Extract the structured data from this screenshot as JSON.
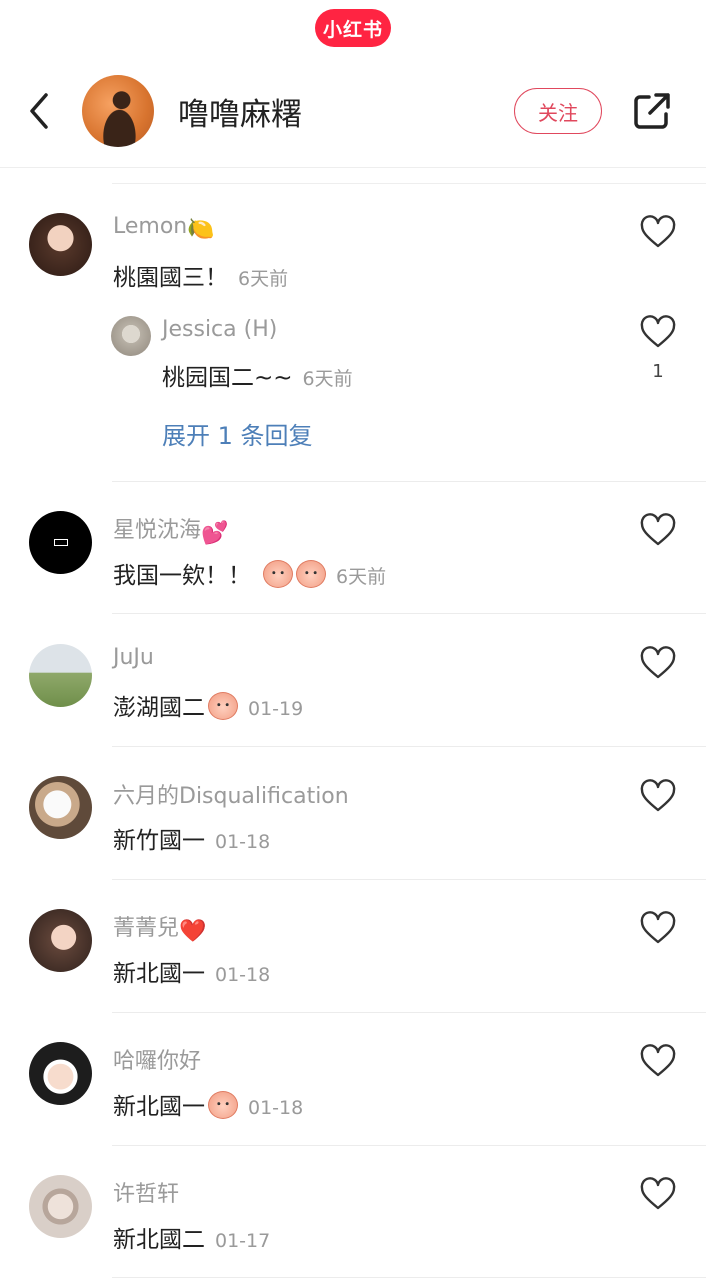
{
  "app": {
    "brand": "小红书",
    "brand_color": "#ff2442"
  },
  "header": {
    "author_name": "噜噜麻糬",
    "follow_label": "关注",
    "icons": {
      "back": "chevron-left-icon",
      "share": "share-external-icon"
    }
  },
  "comments": [
    {
      "user": "Lemon",
      "user_emoji": "🍋",
      "text": "桃園國三！",
      "date": "6天前",
      "reply": {
        "user": "Jessica (H)",
        "text": "桃园国二~~",
        "date": "6天前",
        "likes": "1"
      },
      "expand_label": "展开 1 条回复"
    },
    {
      "user": "星悦沈海",
      "user_emoji": "💕",
      "text": "我国一欸！！",
      "date": "6天前"
    },
    {
      "user": "JuJu",
      "text": "澎湖國二",
      "date": "01-19"
    },
    {
      "user": "六月的Disqualification",
      "text": "新竹國一",
      "date": "01-18"
    },
    {
      "user": "菁菁兒",
      "user_emoji": "❤️",
      "text": "新北國一",
      "date": "01-18"
    },
    {
      "user": "哈囉你好",
      "text": "新北國一",
      "date": "01-18"
    },
    {
      "user": "许哲轩",
      "text": "新北國二",
      "date": "01-17"
    }
  ]
}
